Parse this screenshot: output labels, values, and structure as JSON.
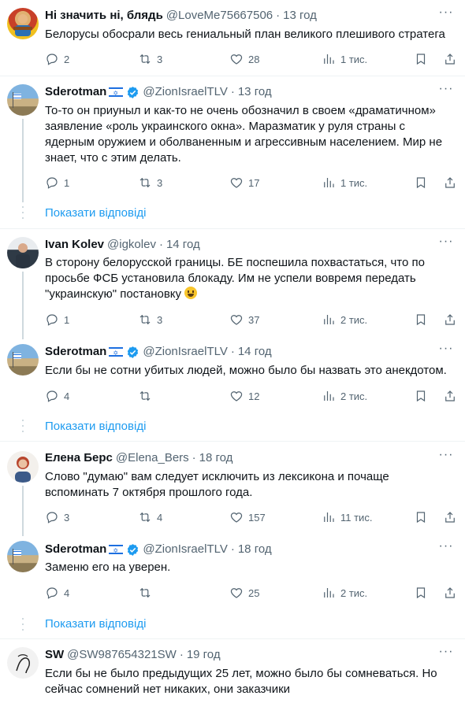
{
  "show_replies_label": "Показати відповіді",
  "tweets": [
    {
      "name": "Ні значить ні, блядь",
      "handle": "@LoveMe75667506",
      "sep": "·",
      "time": "13 год",
      "lines": [
        "Белорусы обосрали весь гениальный план великого плешивого стратега"
      ],
      "replies": "2",
      "retweets": "3",
      "likes": "28",
      "views": "1 тис."
    },
    {
      "name": "Sderotman",
      "handle": "@ZionIsraelTLV",
      "sep": "·",
      "time": "13 год",
      "lines": [
        "То-то он приуныл и как-то не очень обозначил в своем «драматичном»",
        "заявление «роль украинского окна». Маразматик у руля страны с",
        "ядерным оружием и оболваненным и агрессивным населением. Мир не",
        "знает, что с этим делать."
      ],
      "replies": "1",
      "retweets": "3",
      "likes": "17",
      "views": "1 тис."
    },
    {
      "name": "Ivan Kolev",
      "handle": "@igkolev",
      "sep": "·",
      "time": "14 год",
      "lines": [
        "В сторону белорусской границы. БЕ поспешила похвастаться, что по",
        "просьбе ФСБ установила блокаду. Им не успели вовремя передать",
        "\"украинскую\" постановку"
      ],
      "replies": "1",
      "retweets": "3",
      "likes": "37",
      "views": "2 тис."
    },
    {
      "name": "Sderotman",
      "handle": "@ZionIsraelTLV",
      "sep": "·",
      "time": "14 год",
      "lines": [
        "Если бы не сотни убитых людей, можно было бы назвать это анекдотом."
      ],
      "replies": "4",
      "retweets": "",
      "likes": "12",
      "views": "2 тис."
    },
    {
      "name": "Елена Берс",
      "handle": "@Elena_Bers",
      "sep": "·",
      "time": "18 год",
      "lines": [
        "Слово \"думаю\" вам следует исключить из лексикона и почаще",
        "вспоминать 7 октября прошлого года."
      ],
      "replies": "3",
      "retweets": "4",
      "likes": "157",
      "views": "11 тис."
    },
    {
      "name": "Sderotman",
      "handle": "@ZionIsraelTLV",
      "sep": "·",
      "time": "18 год",
      "lines": [
        "Заменю его на уверен."
      ],
      "replies": "4",
      "retweets": "",
      "likes": "25",
      "views": "2 тис."
    },
    {
      "name": "SW",
      "handle": "@SW987654321SW",
      "sep": "·",
      "time": "19 год",
      "lines": [
        "Если бы не было предыдущих 25 лет, можно было бы сомневаться. Но",
        "сейчас сомнений нет никаких, они заказчики"
      ]
    }
  ]
}
